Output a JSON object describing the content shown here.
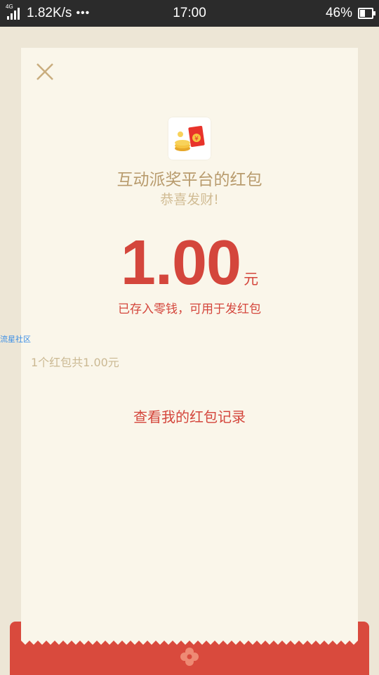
{
  "status_bar": {
    "network": "4G",
    "speed": "1.82K/s",
    "more": "•••",
    "time": "17:00",
    "battery": "46%"
  },
  "card": {
    "sender": "互动派奖平台的红包",
    "wish": "恭喜发财!",
    "amount": "1.00",
    "unit": "元",
    "note": "已存入零钱，可用于发红包",
    "summary": "1个红包共1.00元",
    "records_link": "查看我的红包记录"
  },
  "watermark": "流星社区",
  "colors": {
    "accent_red": "#d4463c",
    "envelope_red": "#d94a3d",
    "gold_text": "#b89b6d",
    "card_bg": "#faf6ea",
    "page_bg": "#ede6d6"
  },
  "icons": {
    "close": "close-icon",
    "app": "red-packet-app-icon",
    "emblem": "flower-emblem-icon"
  }
}
